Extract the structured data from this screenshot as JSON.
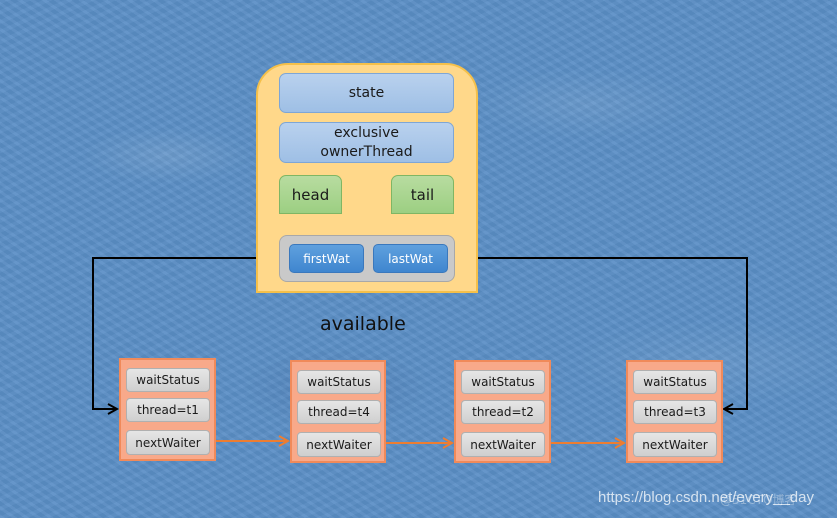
{
  "sync_object": {
    "state": "state",
    "owner_line1": "exclusive",
    "owner_line2": "ownerThread",
    "head": "head",
    "tail": "tail",
    "first_waiter": "firstWat",
    "last_waiter": "lastWat"
  },
  "caption": "available",
  "nodes": [
    {
      "wait_status": "waitStatus",
      "thread": "thread=t1",
      "next": "nextWaiter"
    },
    {
      "wait_status": "waitStatus",
      "thread": "thread=t4",
      "next": "nextWaiter"
    },
    {
      "wait_status": "waitStatus",
      "thread": "thread=t2",
      "next": "nextWaiter"
    },
    {
      "wait_status": "waitStatus",
      "thread": "thread=t3",
      "next": "nextWaiter"
    }
  ],
  "watermark": {
    "url": "https://blog.csdn.net/every__day",
    "overlay": "@51CTO博客"
  },
  "colors": {
    "background": "#5b8fc6",
    "container_fill": "#ffd88a",
    "node_fill": "#f8a98a",
    "link_arrow": "#ed7d31",
    "pointer_arrow": "#000000"
  }
}
